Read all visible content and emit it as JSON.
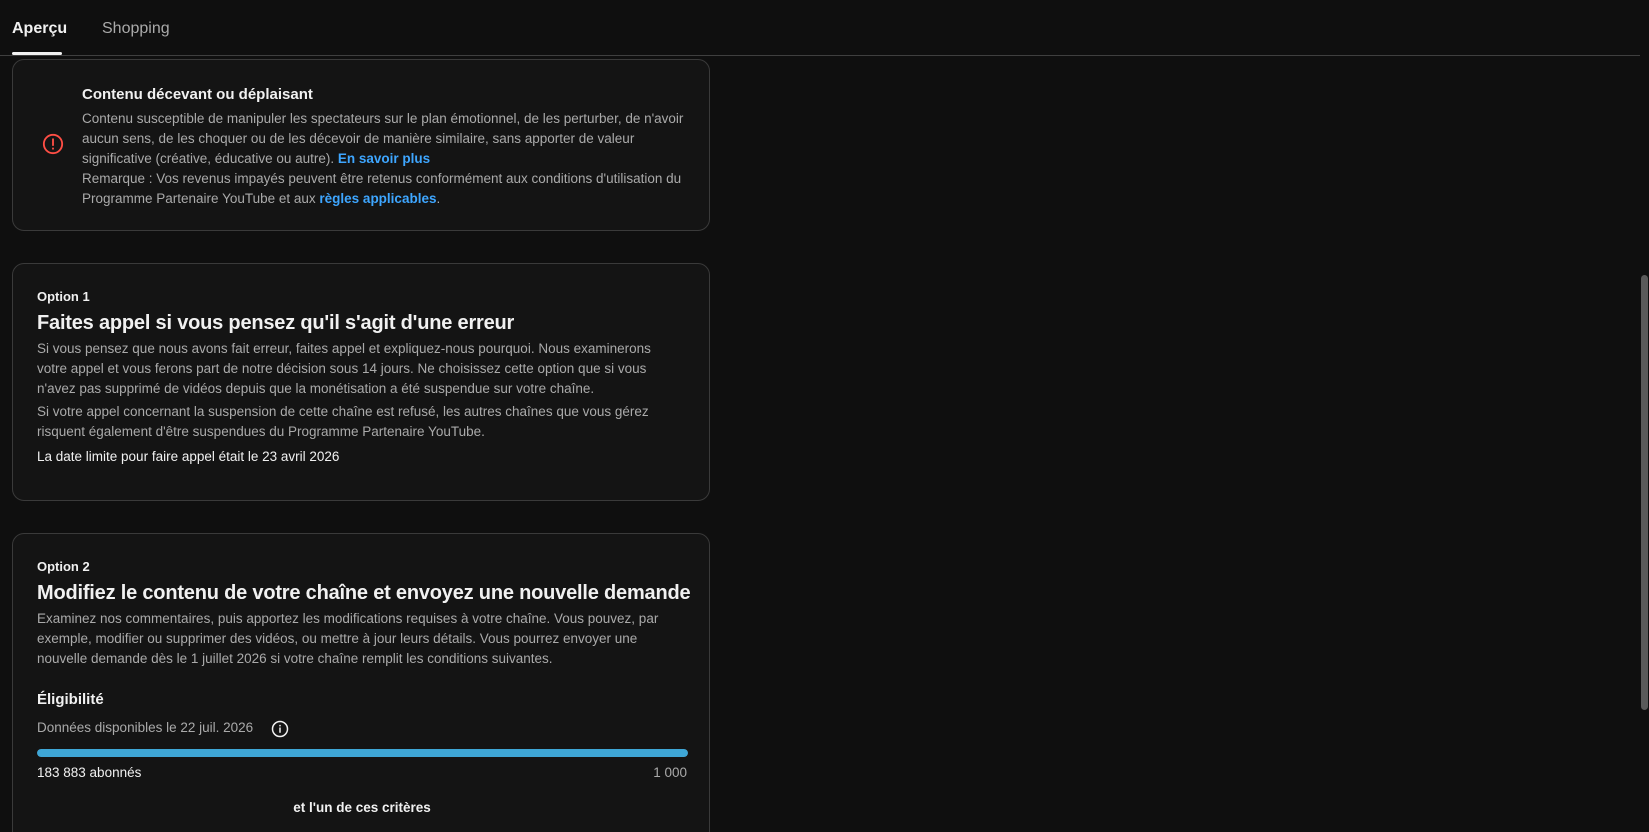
{
  "tabs": [
    {
      "label": "Aperçu",
      "active": true
    },
    {
      "label": "Shopping",
      "active": false
    }
  ],
  "colors": {
    "background": "#0f0f0f",
    "accent_link": "#3ea6ff",
    "warning_red": "#ff4e45",
    "progress_blue": "#3ea6d6"
  },
  "policy": {
    "icon": "error-circle-icon",
    "title": "Contenu décevant ou déplaisant",
    "description": "Contenu susceptible de manipuler les spectateurs sur le plan émotionnel, de les perturber, de n'avoir aucun sens, de les choquer ou de les décevoir de manière similaire, sans apporter de valeur significative (créative, éducative ou autre).",
    "learn_more": "En savoir plus",
    "note_prefix": "Remarque : Vos revenus impayés peuvent être retenus conformément aux conditions d'utilisation du Programme Partenaire YouTube et aux",
    "note_link": "règles applicables",
    "note_suffix": "."
  },
  "option1": {
    "label": "Option 1",
    "title": "Faites appel si vous pensez qu'il s'agit d'une erreur",
    "paragraph1": "Si vous pensez que nous avons fait erreur, faites appel et expliquez-nous pourquoi. Nous examinerons votre appel et vous ferons part de notre décision sous 14 jours. Ne choisissez cette option que si vous n'avez pas supprimé de vidéos depuis que la monétisation a été suspendue sur votre chaîne.",
    "paragraph2": "Si votre appel concernant la suspension de cette chaîne est refusé, les autres chaînes que vous gérez risquent également d'être suspendues du Programme Partenaire YouTube.",
    "deadline": "La date limite pour faire appel était le 23 avril 2026"
  },
  "option2": {
    "label": "Option 2",
    "title": "Modifiez le contenu de votre chaîne et envoyez une nouvelle demande",
    "paragraph": "Examinez nos commentaires, puis apportez les modifications requises à votre chaîne. Vous pouvez, par exemple, modifier ou supprimer des vidéos, ou mettre à jour leurs détails. Vous pourrez envoyer une nouvelle demande dès le 1 juillet 2026 si votre chaîne remplit les conditions suivantes.",
    "eligibility_title": "Éligibilité",
    "data_available": "Données disponibles le 22 juil. 2026",
    "info_icon": "info-icon",
    "subscribers_text": "183 883 abonnés",
    "subscribers_target": "1 000",
    "progress_fraction": 1.0,
    "criteria_text": "et l'un de ces critères"
  }
}
